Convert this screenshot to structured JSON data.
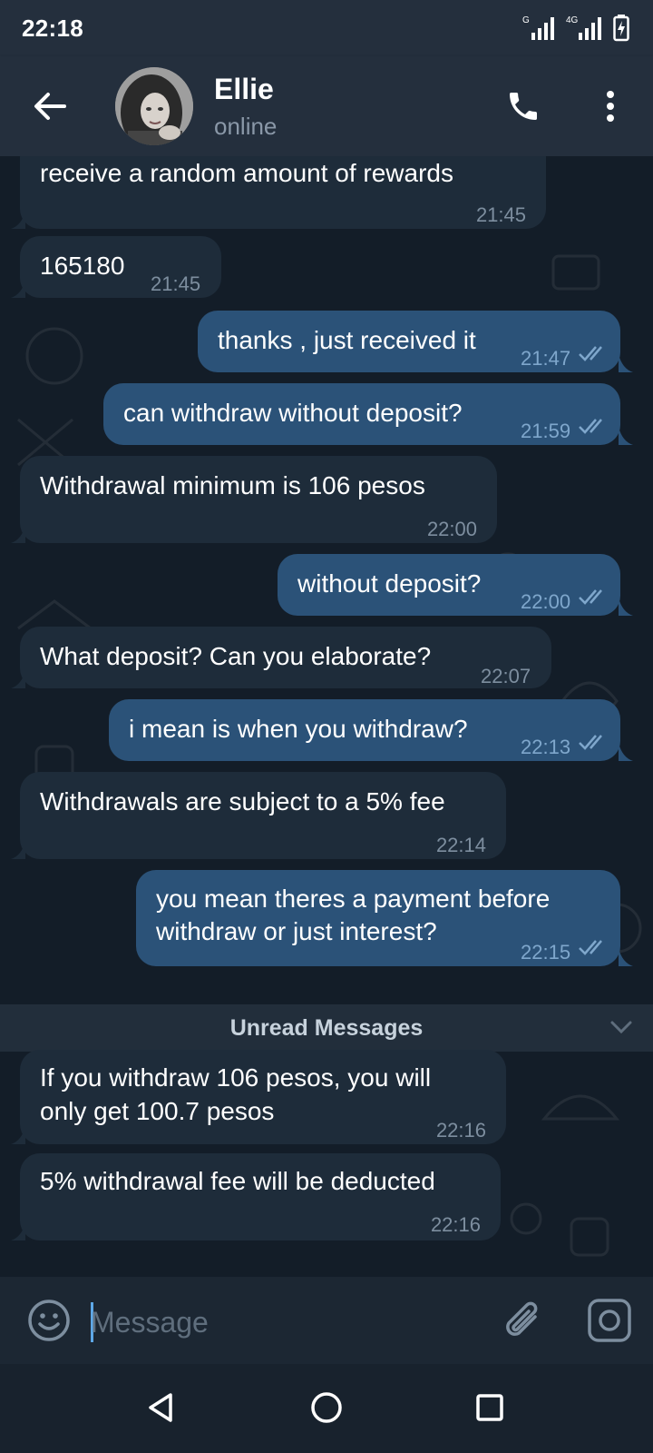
{
  "status_bar": {
    "time": "22:18",
    "signal1_label": "G",
    "signal2_label": "4G"
  },
  "header": {
    "name": "Ellie",
    "status": "online"
  },
  "messages": [
    {
      "direction": "in",
      "text": "receive a random amount of rewards",
      "time": "21:45"
    },
    {
      "direction": "in",
      "text": "165180",
      "time": "21:45"
    },
    {
      "direction": "out",
      "text": "thanks , just received it",
      "time": "21:47",
      "read": true
    },
    {
      "direction": "out",
      "text": "can withdraw without deposit?",
      "time": "21:59",
      "read": true
    },
    {
      "direction": "in",
      "text": "Withdrawal minimum is 106 pesos",
      "time": "22:00"
    },
    {
      "direction": "out",
      "text": "without deposit?",
      "time": "22:00",
      "read": true
    },
    {
      "direction": "in",
      "text": "What deposit? Can you elaborate?",
      "time": "22:07"
    },
    {
      "direction": "out",
      "text": "i mean is when you withdraw?",
      "time": "22:13",
      "read": true
    },
    {
      "direction": "in",
      "text": "Withdrawals are subject to a 5% fee",
      "time": "22:14"
    },
    {
      "direction": "out",
      "text": "you mean theres a payment before\nwithdraw or just interest?",
      "time": "22:15",
      "read": true
    },
    {
      "direction": "in",
      "text": "If you withdraw 106 pesos, you will\nonly get 100.7 pesos",
      "time": "22:16"
    },
    {
      "direction": "in",
      "text": "5% withdrawal fee will be deducted",
      "time": "22:16"
    }
  ],
  "unread_divider": "Unread Messages",
  "input": {
    "placeholder": "Message"
  },
  "icons": {
    "back": "arrow-left-icon",
    "call": "phone-icon",
    "menu": "kebab-menu-icon",
    "emoji": "smiley-icon",
    "attach": "paperclip-icon",
    "camera": "camera-icon"
  },
  "colors": {
    "header_bg": "#242f3d",
    "chat_bg": "#131d28",
    "incoming_bubble": "#1e2c3a",
    "outgoing_bubble": "#2b5278",
    "accent": "#5ea8e8"
  }
}
